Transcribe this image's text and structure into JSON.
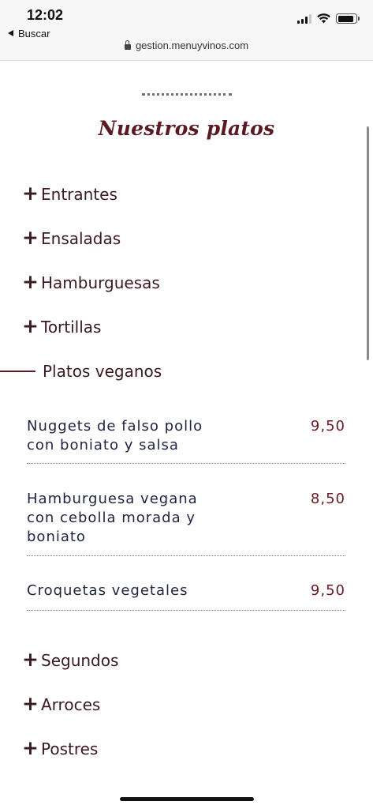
{
  "status_bar": {
    "time": "12:02",
    "back_label": "Buscar",
    "battery_level": 0.9
  },
  "browser": {
    "url": "gestion.menuyvinos.com"
  },
  "page": {
    "title": "Nuestros platos"
  },
  "categories": [
    {
      "label": "Entrantes",
      "expanded": false
    },
    {
      "label": "Ensaladas",
      "expanded": false
    },
    {
      "label": "Hamburguesas",
      "expanded": false
    },
    {
      "label": "Tortillas",
      "expanded": false
    },
    {
      "label": "Platos veganos",
      "expanded": true
    },
    {
      "label": "Segundos",
      "expanded": false
    },
    {
      "label": "Arroces",
      "expanded": false
    },
    {
      "label": "Postres",
      "expanded": false
    }
  ],
  "dishes": [
    {
      "name_lines": [
        "Nuggets de falso pollo",
        "con boniato y salsa"
      ],
      "price": "9,50"
    },
    {
      "name_lines": [
        "Hamburguesa vegana",
        "con cebolla morada y",
        "boniato"
      ],
      "price": "8,50"
    },
    {
      "name_lines": [
        "Croquetas vegetales"
      ],
      "price": "9,50"
    }
  ],
  "icons": {
    "plus": "+",
    "collapse": "minus-line",
    "lock": "lock-icon",
    "back": "back-arrow-icon"
  },
  "colors": {
    "title": "#5a1a22",
    "text": "#3a1a1f",
    "dish_name": "#1e2440",
    "price": "#6b1a24"
  }
}
